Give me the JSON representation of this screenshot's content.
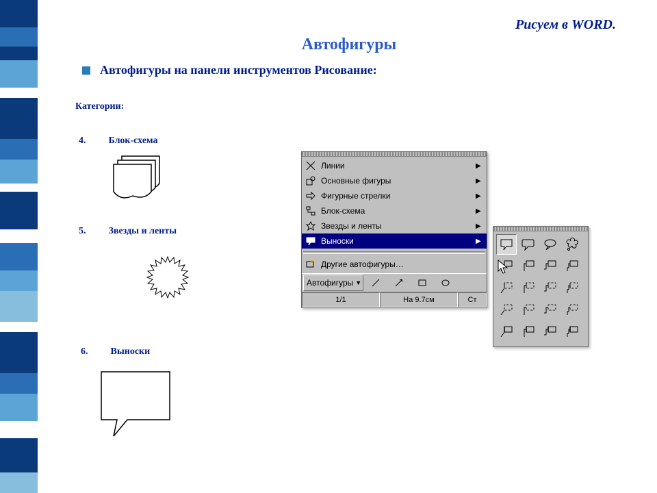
{
  "header": {
    "kicker": "Рисуем в WORD.",
    "title": "Автофигуры"
  },
  "bullet": "Автофигуры на панели инструментов Рисование:",
  "categories_label": "Категории:",
  "items": [
    {
      "num": "4.",
      "label": "Блок-схема"
    },
    {
      "num": "5.",
      "label": "Звезды и ленты"
    },
    {
      "num": "6.",
      "label": "Выноски"
    }
  ],
  "menu": {
    "items": [
      {
        "label": "Линии"
      },
      {
        "label": "Основные фигуры"
      },
      {
        "label": "Фигурные стрелки"
      },
      {
        "label": "Блок-схема"
      },
      {
        "label": "Звезды и ленты"
      },
      {
        "label": "Выноски",
        "selected": true
      },
      {
        "label": "Другие автофигуры…",
        "noarrow": true
      }
    ],
    "toolbar_label": "Автофигуры",
    "status": {
      "page": "1/1",
      "pos": "На 9.7см",
      "col": "Ст"
    }
  }
}
